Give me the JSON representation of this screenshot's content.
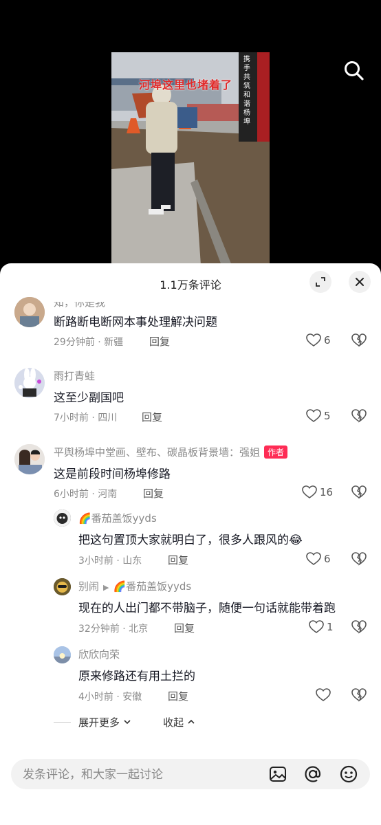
{
  "video": {
    "overlay_text": "河埠这里也堵着了",
    "sign_text": "携手共筑和谐杨埠"
  },
  "header": {
    "title": "1.1万条评论"
  },
  "comments": [
    {
      "user": "知，你是我",
      "text": "断路断电断网本事处理解决问题",
      "time_loc": "29分钟前 · 新疆",
      "reply": "回复",
      "likes": "6"
    },
    {
      "user": "雨打青蛙",
      "text": "这至少副国吧",
      "time_loc": "7小时前 · 四川",
      "reply": "回复",
      "likes": "5"
    },
    {
      "user": "平舆杨埠中堂画、壁布、碳晶板背景墙：强姐",
      "badge": "作者",
      "text": "这是前段时间杨埠修路",
      "time_loc": "6小时前 · 河南",
      "reply": "回复",
      "likes": "16"
    }
  ],
  "replies": [
    {
      "user": "🌈番茄盖饭yyds",
      "text": "把这句置顶大家就明白了，很多人跟风的😂",
      "time_loc": "3小时前 · 山东",
      "reply": "回复",
      "likes": "6"
    },
    {
      "user": "别闹",
      "reply_to": "🌈番茄盖饭yyds",
      "text": "现在的人出门都不带脑子，随便一句话就能带着跑",
      "time_loc": "32分钟前 · 北京",
      "reply": "回复",
      "likes": "1"
    },
    {
      "user": "欣欣向荣",
      "text": "原来修路还有用土拦的",
      "time_loc": "4小时前 · 安徽",
      "reply": "回复",
      "likes": ""
    }
  ],
  "thread_controls": {
    "expand": "展开更多",
    "collapse": "收起"
  },
  "composer": {
    "placeholder": "发条评论，和大家一起讨论"
  },
  "icons": [
    "search-icon",
    "expand-icon",
    "close-icon",
    "heart-icon",
    "dislike-icon",
    "image-icon",
    "mention-icon",
    "emoji-icon"
  ],
  "colors": {
    "author_badge": "#fe2c55",
    "sheet_bg": "#ffffff"
  }
}
